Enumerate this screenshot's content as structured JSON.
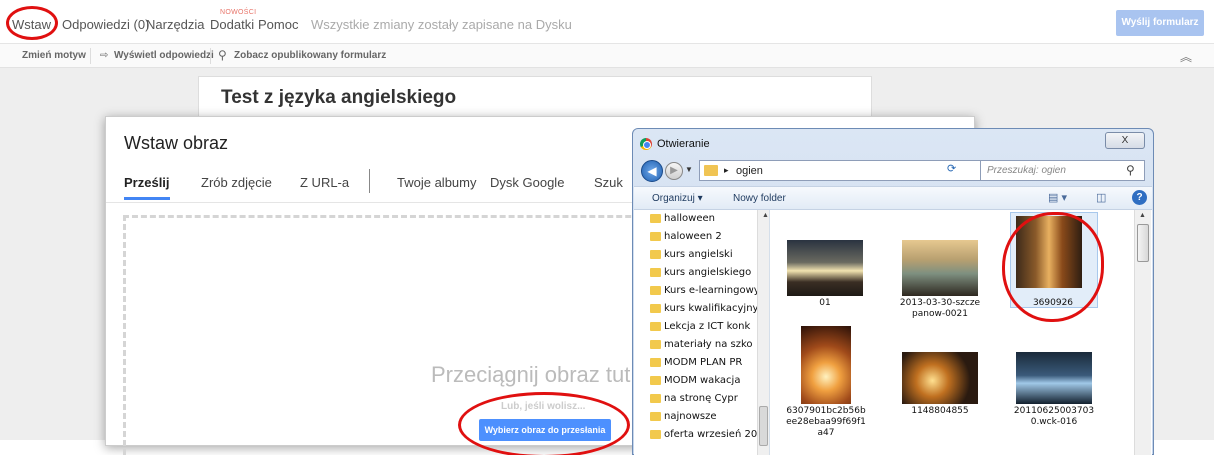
{
  "menubar": {
    "items": [
      "Wstaw",
      "Odpowiedzi (0)",
      "Narzędzia",
      "Dodatki",
      "Pomoc"
    ],
    "new_badge": "NOWOŚCI",
    "status": "Wszystkie zmiany zostały zapisane na Dysku",
    "send_label": "Wyślij formularz"
  },
  "toolbar": {
    "theme": "Zmień motyw",
    "responses": "Wyświetl odpowiedzi",
    "published": "Zobacz opublikowany formularz"
  },
  "form": {
    "title": "Test z języka angielskiego"
  },
  "insert_dialog": {
    "title": "Wstaw obraz",
    "tabs": [
      "Prześlij",
      "Zrób zdjęcie",
      "Z URL-a",
      "Twoje albumy",
      "Dysk Google",
      "Szuk"
    ],
    "drop_text": "Przeciągnij obraz tut",
    "or_text": "Lub, jeśli wolisz...",
    "choose_label": "Wybierz obraz do przesłania"
  },
  "open_dialog": {
    "title": "Otwieranie",
    "close_label": "X",
    "path": "ogien",
    "search_placeholder": "Przeszukaj: ogien",
    "organize": "Organizuj ▾",
    "new_folder": "Nowy folder",
    "folders": [
      "halloween",
      "haloween 2",
      "kurs angielski",
      "kurs angielskiego",
      "Kurs e-learningowy",
      "kurs kwalifikacyjny",
      "Lekcja z ICT konk",
      "materiały na szko",
      "MODM PLAN PR",
      "MODM wakacja",
      "na stronę Cypr",
      "najnowsze",
      "oferta wrzesień 20"
    ],
    "files": [
      "01",
      "2013-03-30-szczepanow-0021",
      "3690926",
      "6307901bc2b56bee28ebaa99f69f1a47",
      "1148804855",
      "201106250037030.wck-016"
    ]
  },
  "icons": {
    "back": "back-arrow-icon",
    "forward": "forward-arrow-icon",
    "folder": "folder-icon",
    "search": "magnifier-icon",
    "help": "help-icon"
  }
}
